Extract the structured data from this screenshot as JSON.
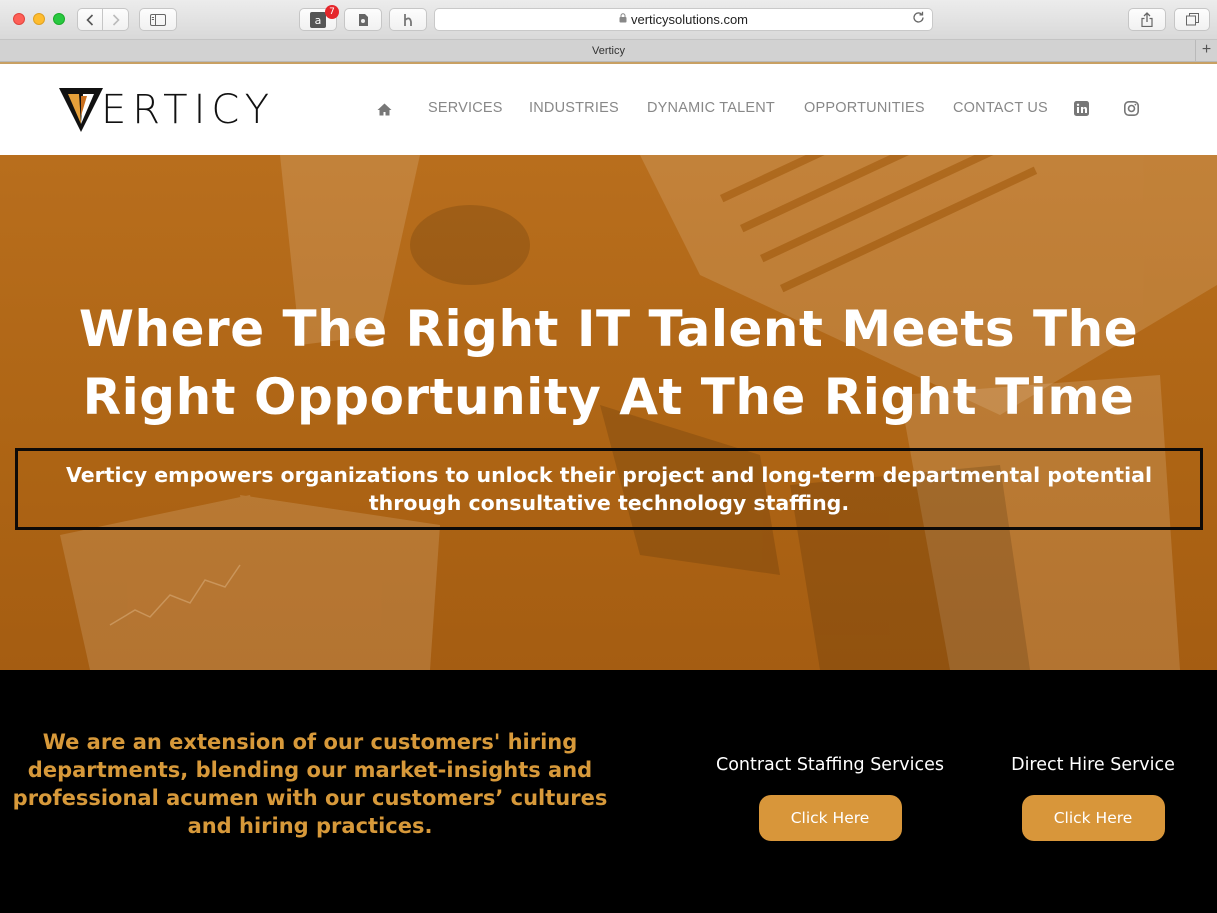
{
  "browser": {
    "url": "verticysolutions.com",
    "tab_title": "Verticy",
    "extension_badge": "7",
    "new_tab_glyph": "+"
  },
  "site": {
    "logo_text": "ERTICY",
    "logo_mark": "V",
    "nav": [
      {
        "label": "SERVICES"
      },
      {
        "label": "INDUSTRIES"
      },
      {
        "label": "DYNAMIC TALENT"
      },
      {
        "label": "OPPORTUNITIES"
      },
      {
        "label": "CONTACT US"
      }
    ],
    "icons": [
      "home-icon",
      "linkedin-icon",
      "instagram-icon"
    ]
  },
  "hero": {
    "title_line1": "Where The Right IT Talent Meets The",
    "title_line2": "Right Opportunity At The Right Time",
    "tagline": "Verticy empowers organizations to unlock their project and long-term departmental potential through consultative technology staffing."
  },
  "band": {
    "statement": "We are an extension of our customers' hiring departments, blending our market-insights and professional acumen with our customers’ cultures and hiring practices.",
    "services": [
      {
        "title": "Contract Staffing Services",
        "button": "Click Here"
      },
      {
        "title": "Direct Hire Service",
        "button": "Click Here"
      }
    ]
  },
  "colors": {
    "accent_gold": "#d8963a",
    "hero_orange": "#ad6414",
    "nav_gray": "#888888"
  }
}
